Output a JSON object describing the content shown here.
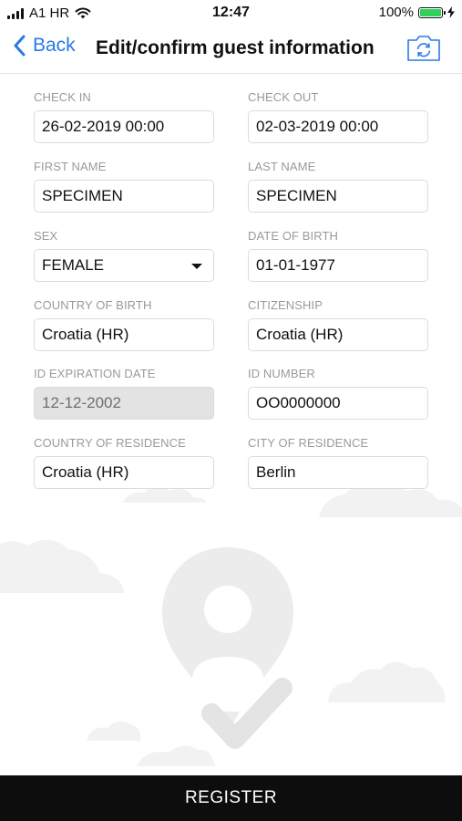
{
  "status_bar": {
    "carrier": "A1 HR",
    "time": "12:47",
    "battery": "100%",
    "battery_level": 1.0
  },
  "nav": {
    "back_label": "Back",
    "title": "Edit/confirm guest information",
    "camera_icon": "camera-rotate-icon"
  },
  "form": {
    "check_in": {
      "label": "CHECK IN",
      "value": "26-02-2019 00:00"
    },
    "check_out": {
      "label": "CHECK OUT",
      "value": "02-03-2019 00:00"
    },
    "first_name": {
      "label": "FIRST NAME",
      "value": "SPECIMEN"
    },
    "last_name": {
      "label": "LAST NAME",
      "value": "SPECIMEN"
    },
    "sex": {
      "label": "SEX",
      "value": "FEMALE"
    },
    "date_of_birth": {
      "label": "DATE OF BIRTH",
      "value": "01-01-1977"
    },
    "country_of_birth": {
      "label": "COUNTRY OF BIRTH",
      "value": "Croatia (HR)"
    },
    "citizenship": {
      "label": "CITIZENSHIP",
      "value": "Croatia (HR)"
    },
    "id_expiration_date": {
      "label": "ID EXPIRATION DATE",
      "value": "12-12-2002",
      "disabled": true
    },
    "id_number": {
      "label": "ID NUMBER",
      "value": "OO0000000"
    },
    "country_of_residence": {
      "label": "COUNTRY OF RESIDENCE",
      "value": "Croatia (HR)"
    },
    "city_of_residence": {
      "label": "CITY OF RESIDENCE",
      "value": "Berlin"
    }
  },
  "register": {
    "label": "REGISTER"
  },
  "colors": {
    "accent": "#2a79e6",
    "register_bg": "#0d0d0d",
    "label": "#9a9a9a",
    "disabled_bg": "#e3e3e3",
    "battery": "#2fd158"
  }
}
